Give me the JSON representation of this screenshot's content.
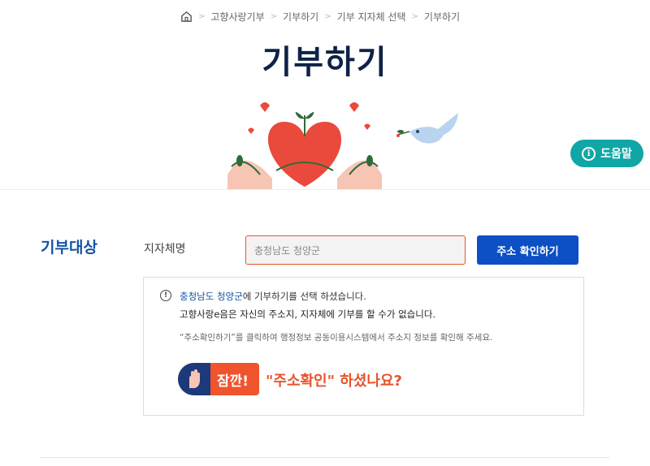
{
  "breadcrumb": [
    "고향사랑기부",
    "기부하기",
    "기부 지자체 선택",
    "기부하기"
  ],
  "page_title": "기부하기",
  "help_label": "도움말",
  "section": {
    "title": "기부대상",
    "field_label": "지자체명",
    "input_value": "충청남도 청양군",
    "confirm_button": "주소 확인하기"
  },
  "notice": {
    "region_name": "충청남도 청양군",
    "line1_suffix": "에 기부하기를 선택 하셨습니다.",
    "line2": "고향사랑e음은 자신의 주소지, 지자체에 기부를 할 수가 없습니다.",
    "line3": "“주소확인하기”를 클릭하여 행정정보 공동이용시스템에서 주소지 정보를 확인해 주세요.",
    "badge_text": "잠깐!",
    "question": "\"주소확인\" 하셨나요?"
  },
  "colors": {
    "title": "#0f2246",
    "accent_blue": "#1254a8",
    "button_blue": "#0d4fc4",
    "orange": "#e8542c",
    "teal": "#11a6a6"
  },
  "icons": [
    "home-icon",
    "info-icon",
    "warning-icon",
    "hand-icon"
  ]
}
